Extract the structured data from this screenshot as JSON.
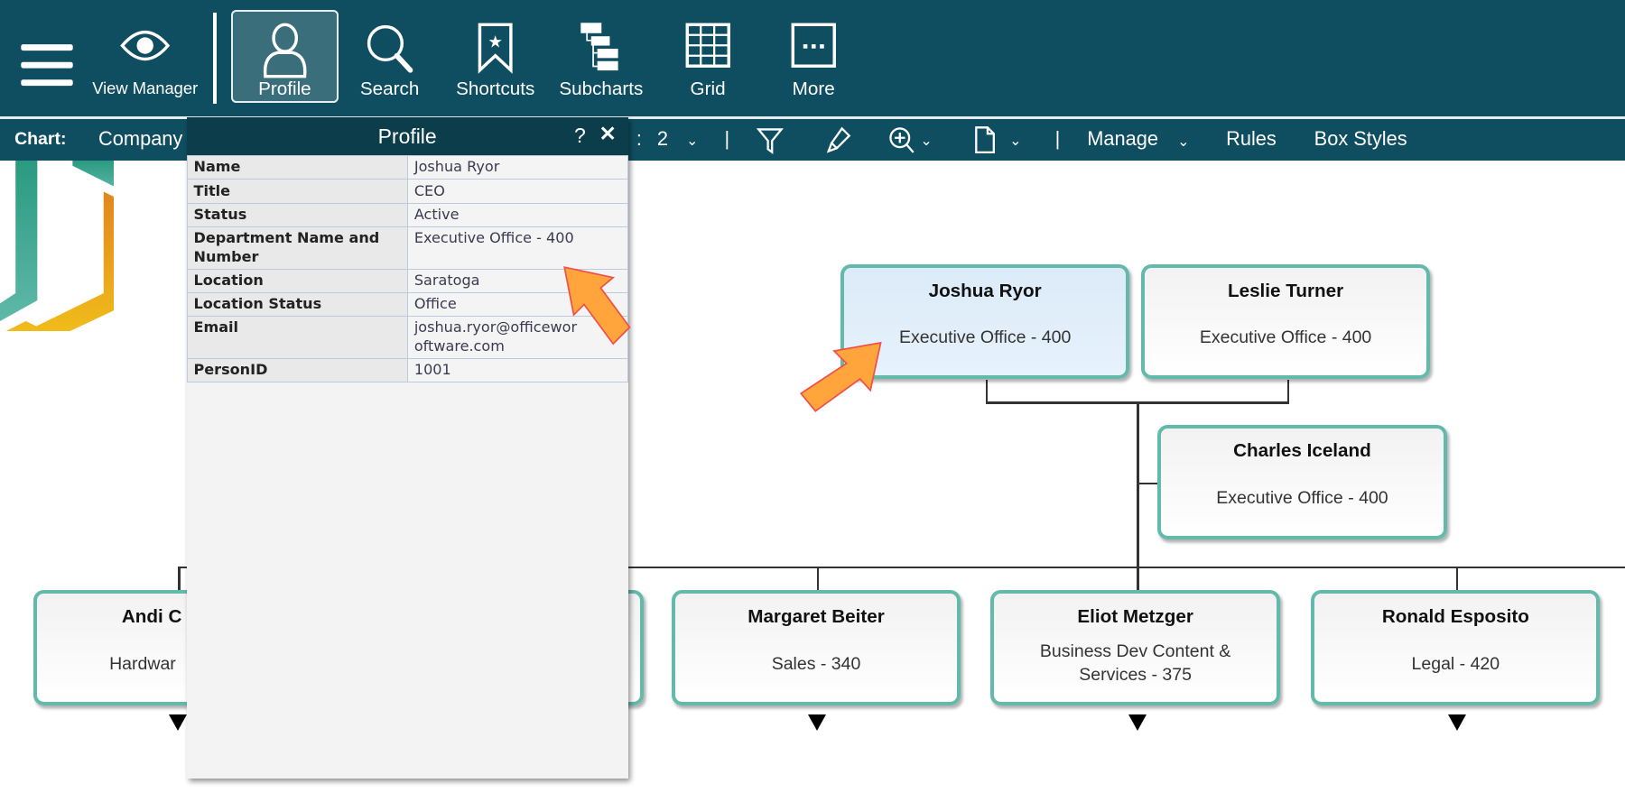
{
  "toolbar": {
    "items": [
      {
        "label": "",
        "icon": "menu-icon"
      },
      {
        "label": "View Manager",
        "icon": "eye-icon"
      },
      {
        "label": "Profile",
        "icon": "person-icon",
        "active": true
      },
      {
        "label": "Search",
        "icon": "search-icon"
      },
      {
        "label": "Shortcuts",
        "icon": "bookmark-star-icon"
      },
      {
        "label": "Subcharts",
        "icon": "hierarchy-icon"
      },
      {
        "label": "Grid",
        "icon": "grid-icon"
      },
      {
        "label": "More",
        "icon": "more-icon"
      }
    ]
  },
  "chartbar": {
    "chart_label": "Chart:",
    "chart_name": "Company",
    "levels_sep": ":",
    "levels": "2",
    "manage": "Manage",
    "rules": "Rules",
    "box_styles": "Box Styles"
  },
  "profile": {
    "title": "Profile",
    "help": "?",
    "close": "✕",
    "rows": [
      {
        "k": "Name",
        "v": "Joshua Ryor"
      },
      {
        "k": "Title",
        "v": "CEO"
      },
      {
        "k": "Status",
        "v": "Active"
      },
      {
        "k": "Department Name and Number",
        "v": "Executive Office - 400"
      },
      {
        "k": "Location",
        "v": "Saratoga"
      },
      {
        "k": "Location Status",
        "v": "Office"
      },
      {
        "k": "Email",
        "v": "joshua.ryor@officewor",
        "v2": "oftware.com"
      },
      {
        "k": "PersonID",
        "v": "1001"
      }
    ]
  },
  "chart": {
    "boxes": [
      {
        "name": "Joshua Ryor",
        "dept": "Executive Office - 400",
        "selected": true
      },
      {
        "name": "Leslie Turner",
        "dept": "Executive Office - 400"
      },
      {
        "name": "Charles Iceland",
        "dept": "Executive Office - 400"
      },
      {
        "name": "Andi C",
        "dept": "Hardwar"
      },
      {
        "name": "Margaret Beiter",
        "dept": "Sales - 340"
      },
      {
        "name": "Eliot Metzger",
        "dept": "Business Dev Content & Services - 375"
      },
      {
        "name": "Ronald Esposito",
        "dept": "Legal - 420"
      }
    ]
  },
  "colors": {
    "toolbar": "#0f4e60",
    "panel_header": "#0b3d4a",
    "box_border": "#63b9aa",
    "selected_box": "#dcebf8",
    "annotation_arrow": "#ffa53c"
  }
}
